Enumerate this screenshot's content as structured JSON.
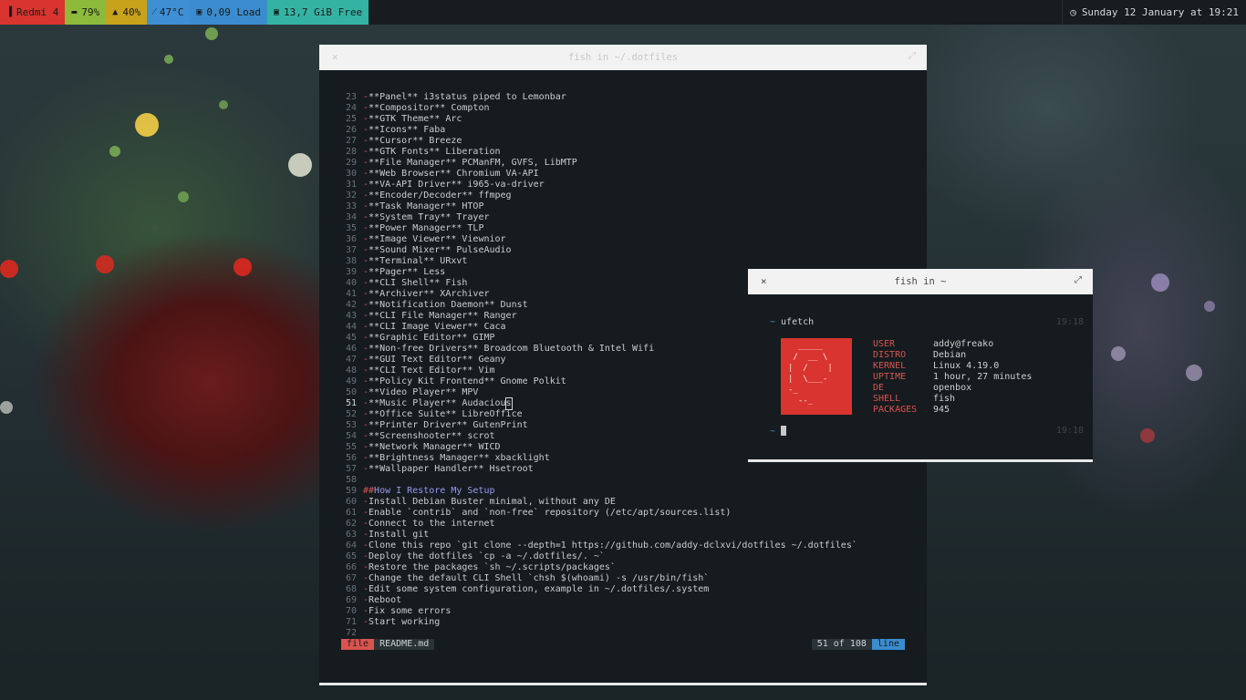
{
  "statusbar": {
    "segments": [
      {
        "icon": "signal-icon",
        "glyph": "▐",
        "text": "Redmi 4",
        "color": "#d9342f"
      },
      {
        "icon": "battery-icon",
        "glyph": "▬",
        "text": "79%",
        "color": "#8cbb3c"
      },
      {
        "icon": "bell-icon",
        "glyph": "▲",
        "text": "40%",
        "color": "#c9a21c"
      },
      {
        "icon": "thermometer-icon",
        "glyph": "⁄",
        "text": "47°C",
        "color": "#3e8fd4"
      },
      {
        "icon": "cpu-icon",
        "glyph": "▣",
        "text": "0,09 Load",
        "color": "#3a8ccf"
      },
      {
        "icon": "disk-icon",
        "glyph": "▣",
        "text": "13,7 GiB Free",
        "color": "#34b3a3"
      }
    ],
    "clock": {
      "icon": "clock-icon",
      "glyph": "◷",
      "text": "Sunday 12 January at 19:21"
    }
  },
  "main_window": {
    "title": "fish in ~/.dotfiles",
    "close_glyph": "×",
    "max_glyph": "⤢",
    "lines": [
      {
        "n": "23",
        "t": "**Panel** i3status piped to Lemonbar"
      },
      {
        "n": "24",
        "t": "**Compositor** Compton"
      },
      {
        "n": "25",
        "t": "**GTK Theme** Arc"
      },
      {
        "n": "26",
        "t": "**Icons** Faba"
      },
      {
        "n": "27",
        "t": "**Cursor** Breeze"
      },
      {
        "n": "28",
        "t": "**GTK Fonts** Liberation"
      },
      {
        "n": "29",
        "t": "**File Manager** PCManFM, GVFS, LibMTP"
      },
      {
        "n": "30",
        "t": "**Web Browser** Chromium VA-API"
      },
      {
        "n": "31",
        "t": "**VA-API Driver** i965-va-driver"
      },
      {
        "n": "32",
        "t": "**Encoder/Decoder** ffmpeg"
      },
      {
        "n": "33",
        "t": "**Task Manager** HTOP"
      },
      {
        "n": "34",
        "t": "**System Tray** Trayer"
      },
      {
        "n": "35",
        "t": "**Power Manager** TLP"
      },
      {
        "n": "36",
        "t": "**Image Viewer** Viewnior"
      },
      {
        "n": "37",
        "t": "**Sound Mixer** PulseAudio"
      },
      {
        "n": "38",
        "t": "**Terminal** URxvt"
      },
      {
        "n": "39",
        "t": "**Pager** Less"
      },
      {
        "n": "40",
        "t": "**CLI Shell** Fish"
      },
      {
        "n": "41",
        "t": "**Archiver** XArchiver"
      },
      {
        "n": "42",
        "t": "**Notification Daemon** Dunst"
      },
      {
        "n": "43",
        "t": "**CLI File Manager** Ranger"
      },
      {
        "n": "44",
        "t": "**CLI Image Viewer** Caca"
      },
      {
        "n": "45",
        "t": "**Graphic Editor** GIMP"
      },
      {
        "n": "46",
        "t": "**Non-free Drivers** Broadcom Bluetooth & Intel Wifi"
      },
      {
        "n": "47",
        "t": "**GUI Text Editor** Geany"
      },
      {
        "n": "48",
        "t": "**CLI Text Editor** Vim"
      },
      {
        "n": "49",
        "t": "**Policy Kit Frontend** Gnome Polkit"
      },
      {
        "n": "50",
        "t": "**Video Player** MPV"
      },
      {
        "n": "51",
        "t": "**Music Player** Audaciou",
        "cursor_char": "s"
      },
      {
        "n": "52",
        "t": "**Office Suite** LibreOffice"
      },
      {
        "n": "53",
        "t": "**Printer Driver** GutenPrint"
      },
      {
        "n": "54",
        "t": "**Screenshooter** scrot"
      },
      {
        "n": "55",
        "t": "**Network Manager** WICD"
      },
      {
        "n": "56",
        "t": "**Brightness Manager** xbacklight"
      },
      {
        "n": "57",
        "t": "**Wallpaper Handler** Hsetroot"
      },
      {
        "n": "58",
        "t": ""
      },
      {
        "n": "59",
        "hash": "##",
        "t": "How I Restore My Setup"
      },
      {
        "n": "60",
        "t": "Install Debian Buster minimal, without any DE"
      },
      {
        "n": "61",
        "t": "Enable `contrib` and `non-free` repository (/etc/apt/sources.list)"
      },
      {
        "n": "62",
        "t": "Connect to the internet"
      },
      {
        "n": "63",
        "t": "Install git"
      },
      {
        "n": "64",
        "t": "Clone this repo `git clone --depth=1 https://github.com/addy-dclxvi/dotfiles ~/.dotfiles`"
      },
      {
        "n": "65",
        "t": "Deploy the dotfiles `cp -a ~/.dotfiles/. ~`"
      },
      {
        "n": "66",
        "t": "Restore the packages `sh ~/.scripts/packages`"
      },
      {
        "n": "67",
        "t": "Change the default CLI Shell `chsh $(whoami) -s /usr/bin/fish`"
      },
      {
        "n": "68",
        "t": "Edit some system configuration, example in ~/.dotfiles/.system"
      },
      {
        "n": "69",
        "t": "Reboot"
      },
      {
        "n": "70",
        "t": "Fix some errors"
      },
      {
        "n": "71",
        "t": "Start working"
      },
      {
        "n": "72",
        "t": ""
      }
    ],
    "list_marker": "-",
    "status": {
      "mode": "file",
      "filename": "README.md",
      "position": "51 of 108",
      "line_label": "line"
    }
  },
  "small_window": {
    "title": "fish in ~",
    "close_glyph": "×",
    "max_glyph": "⤢",
    "prompt_glyph": "~",
    "command": "ufetch",
    "time1": "19:18",
    "time2": "19:18",
    "logo": "  _____\n /  __ \\\n|  /    |\n|  \\___-\n-_\n  --_",
    "info": [
      {
        "k": "USER",
        "v": "addy@freako"
      },
      {
        "k": "DISTRO",
        "v": "Debian"
      },
      {
        "k": "KERNEL",
        "v": "Linux 4.19.0"
      },
      {
        "k": "UPTIME",
        "v": "1 hour, 27 minutes"
      },
      {
        "k": "DE",
        "v": "openbox"
      },
      {
        "k": "SHELL",
        "v": "fish"
      },
      {
        "k": "PACKAGES",
        "v": "945"
      }
    ]
  }
}
